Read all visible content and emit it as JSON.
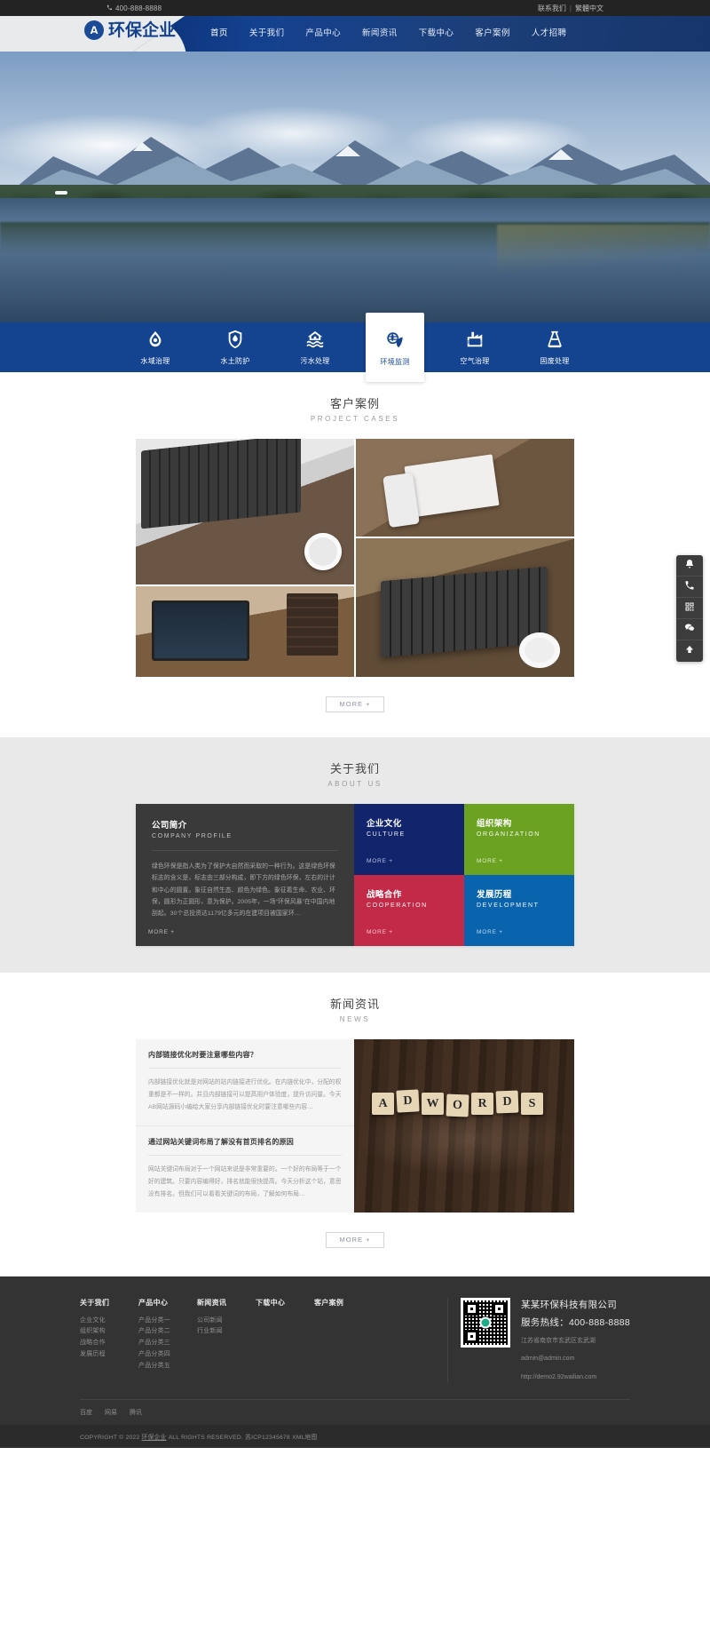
{
  "topbar": {
    "phone": "400-888-8888",
    "phone_icon": "phone-icon",
    "contact_label": "联系我们",
    "separator": "|",
    "lang_label": "繁體中文"
  },
  "header": {
    "logo_mark": "A",
    "logo_text": "环保企业",
    "nav": [
      {
        "label": "首页",
        "active": true
      },
      {
        "label": "关于我们",
        "active": false
      },
      {
        "label": "产品中心",
        "active": false
      },
      {
        "label": "新闻资讯",
        "active": false
      },
      {
        "label": "下载中心",
        "active": false
      },
      {
        "label": "客户案例",
        "active": false
      },
      {
        "label": "人才招聘",
        "active": false
      }
    ]
  },
  "services": [
    {
      "label": "水域治理",
      "icon": "water-droplet-icon",
      "active": false
    },
    {
      "label": "水土防护",
      "icon": "shield-droplet-icon",
      "active": false
    },
    {
      "label": "污水处理",
      "icon": "house-water-icon",
      "active": false
    },
    {
      "label": "环境监测",
      "icon": "globe-leaf-icon",
      "active": true
    },
    {
      "label": "空气治理",
      "icon": "factory-pm25-icon",
      "active": false
    },
    {
      "label": "固废处理",
      "icon": "flask-icon",
      "active": false
    }
  ],
  "cases": {
    "title_cn": "客户案例",
    "title_en": "PROJECT CASES",
    "items": [
      {
        "name": "case-photo-keyboard-notebook"
      },
      {
        "name": "case-photo-phone-notebook"
      },
      {
        "name": "case-photo-laptop-desk"
      },
      {
        "name": "case-photo-workstation"
      }
    ],
    "more_label": "MORE +"
  },
  "about": {
    "title_cn": "关于我们",
    "title_en": "ABOUT US",
    "profile": {
      "title_cn": "公司简介",
      "title_en": "COMPANY PROFILE",
      "body": "绿色环保是指人类为了保护大自然而采取的一种行为。这是绿色环保标志的含义是，标志由三部分构成，即下方的绿色环保，左右的计计和中心的圆置。象征自然生态、颜色为绿色。象征着生命、农业、环保，圆形为正圆形，意为保护。2005年，一场“环保风暴”在中国内地刮起。30个总投资达1179亿多元的在建项目被国家环…",
      "more_label": "MORE +"
    },
    "tiles": [
      {
        "title_cn": "企业文化",
        "title_en": "CULTURE",
        "more_label": "MORE +",
        "color": "#12246b",
        "key": "culture"
      },
      {
        "title_cn": "组织架构",
        "title_en": "ORGANIZATION",
        "more_label": "MORE +",
        "color": "#6ba221",
        "key": "org"
      },
      {
        "title_cn": "战略合作",
        "title_en": "COOPERATION",
        "more_label": "MORE +",
        "color": "#c32a48",
        "key": "coop"
      },
      {
        "title_cn": "发展历程",
        "title_en": "DEVELOPMENT",
        "more_label": "MORE +",
        "color": "#0a64ad",
        "key": "dev"
      }
    ]
  },
  "news": {
    "title_cn": "新闻资讯",
    "title_en": "NEWS",
    "items": [
      {
        "title": "内部链接优化时要注意哪些内容？",
        "desc": "内部链接优化就是对网站的站内链接进行优化。在内链优化中，分配的权重都是不一样的。并且内部链接可以提高用户体验度，提升访问量。今天AB网站源码小编给大家分享内部链接优化时要注意哪些内容…"
      },
      {
        "title": "通过网站关键词布局了解没有首页排名的原因",
        "desc": "网站关键词布局对于一个网站来说是非常重要的。一个好的布局等于一个好的建筑。只要内容编得好，排名就能很快提高。今天分析这个站，意思没有排名。但我们可以看看关键词的布局，了解如何布局…"
      }
    ],
    "image_word": [
      "A",
      "D",
      "W",
      "O",
      "R",
      "D",
      "S"
    ],
    "more_label": "MORE +"
  },
  "footer": {
    "columns": [
      {
        "heading": "关于我们",
        "links": [
          "企业文化",
          "组织架构",
          "战略合作",
          "发展历程"
        ]
      },
      {
        "heading": "产品中心",
        "links": [
          "产品分类一",
          "产品分类二",
          "产品分类三",
          "产品分类四",
          "产品分类五"
        ]
      },
      {
        "heading": "新闻资讯",
        "links": [
          "公司新闻",
          "行业新闻"
        ]
      },
      {
        "heading": "下载中心",
        "links": []
      },
      {
        "heading": "客户案例",
        "links": []
      }
    ],
    "qr_name": "wechat-qr-code",
    "company": {
      "name": "某某环保科技有限公司",
      "hotline": "服务热线：400-888-8888",
      "address": "江苏省南京市玄武区玄武湖",
      "email": "admin@admin.com",
      "website": "http://demo2.92wailian.com"
    },
    "partner_links": [
      "百度",
      "网易",
      "腾讯"
    ],
    "copyright": "COPYRIGHT © 2022 环保企业 ALL RIGHTS RESERVED. 苏ICP12345678 XML地图",
    "copyright_prefix": "COPYRIGHT © 2022 ",
    "copyright_company": "环保企业",
    "copyright_suffix": " ALL RIGHTS RESERVED. 苏ICP12345678 XML地图"
  },
  "floatbar": [
    {
      "icon": "bell-icon",
      "name": "notification-button"
    },
    {
      "icon": "phone-icon",
      "name": "call-button"
    },
    {
      "icon": "qr-icon",
      "name": "qrcode-button"
    },
    {
      "icon": "wechat-icon",
      "name": "wechat-button"
    },
    {
      "icon": "arrow-up-icon",
      "name": "back-to-top-button"
    }
  ],
  "colors": {
    "brand_blue": "#14448f",
    "nav_dark": "#12246b",
    "green": "#6ba221",
    "crimson": "#c32a48",
    "blue": "#0a64ad",
    "topbar_dark": "#232323",
    "footer_dark": "#333333"
  }
}
